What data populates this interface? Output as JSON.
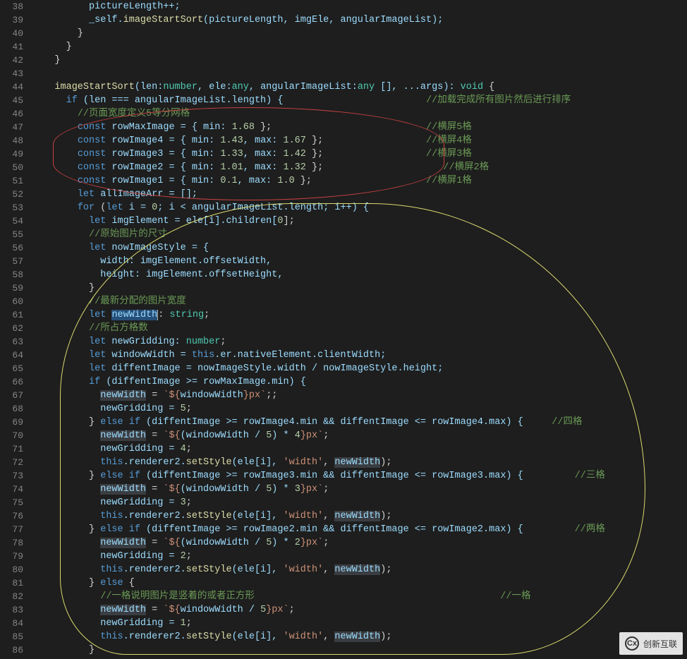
{
  "lines": {
    "start": 38,
    "end": 86
  },
  "code": {
    "l38": "          pictureLength++;",
    "l39_a": "          _self.",
    "l39_fn": "imageStartSort",
    "l39_b": "(pictureLength, imgEle, angularImageList);",
    "l40": "        }",
    "l41": "      }",
    "l42": "    }",
    "l43": "",
    "l44_a": "    ",
    "l44_fn": "imageStartSort",
    "l44_b": "(len:",
    "l44_t1": "number",
    "l44_c": ", ele:",
    "l44_t2": "any",
    "l44_d": ", angularImageList:",
    "l44_t3": "any",
    "l44_e": " [], ...args): ",
    "l44_t4": "void",
    "l44_f": " {",
    "l45_a": "      ",
    "l45_if": "if",
    "l45_b": " (len === angularImageList.length) {",
    "l45_c": "                         ",
    "l45_cmt": "//加载完成所有图片然后进行排序",
    "l46_a": "        ",
    "l46_cmt": "//页面宽度定义5等分网格",
    "l47_a": "        ",
    "l47_kw": "const",
    "l47_b": " rowMaxImage = { min: ",
    "l47_n": "1.68",
    "l47_c": " };",
    "l47_sp": "                           ",
    "l47_cmt": "//横屏5格",
    "l48_a": "        ",
    "l48_kw": "const",
    "l48_b": " rowImage4 = { min: ",
    "l48_n1": "1.43",
    "l48_c": ", max: ",
    "l48_n2": "1.67",
    "l48_d": " };",
    "l48_sp": "                  ",
    "l48_cmt": "//横屏4格",
    "l49_a": "        ",
    "l49_kw": "const",
    "l49_b": " rowImage3 = { min: ",
    "l49_n1": "1.33",
    "l49_c": ", max: ",
    "l49_n2": "1.42",
    "l49_d": " };",
    "l49_sp": "                  ",
    "l49_cmt": "//横屏3格",
    "l50_a": "        ",
    "l50_kw": "const",
    "l50_b": " rowImage2 = { min: ",
    "l50_n1": "1.01",
    "l50_c": ", max: ",
    "l50_n2": "1.32",
    "l50_d": " };",
    "l50_sp": "                     ",
    "l50_cmt": "//横屏2格",
    "l51_a": "        ",
    "l51_kw": "const",
    "l51_b": " rowImage1 = { min: ",
    "l51_n1": "0.1",
    "l51_c": ", max: ",
    "l51_n2": "1.0",
    "l51_d": " };",
    "l51_sp": "                    ",
    "l51_cmt": "//横屏1格",
    "l52_a": "        ",
    "l52_kw": "let",
    "l52_b": " allImageArr = [];",
    "l53_a": "        ",
    "l53_for": "for",
    "l53_b": " (",
    "l53_let": "let",
    "l53_c": " i = ",
    "l53_n0": "0",
    "l53_d": "; i < angularImageList.length; i++) {",
    "l54_a": "          ",
    "l54_kw": "let",
    "l54_b": " imgElement = ele[i].children[",
    "l54_n": "0",
    "l54_c": "];",
    "l55_a": "          ",
    "l55_cmt": "//原始图片的尺寸",
    "l56_a": "          ",
    "l56_kw": "let",
    "l56_b": " nowImageStyle = {",
    "l57": "            width: imgElement.offsetWidth,",
    "l58": "            height: imgElement.offsetHeight,",
    "l59": "          }",
    "l60_a": "          ",
    "l60_cmt": "//最新分配的图片宽度",
    "l61_a": "          ",
    "l61_kw": "let",
    "l61_sp": " ",
    "l61_hl": "newWidth",
    "l61_b": ": ",
    "l61_t": "string",
    "l61_c": ";",
    "l62_a": "          ",
    "l62_cmt": "//所占方格数",
    "l63_a": "          ",
    "l63_kw": "let",
    "l63_b": " newGridding: ",
    "l63_t": "number",
    "l63_c": ";",
    "l64_a": "          ",
    "l64_kw": "let",
    "l64_b": " windowWidth = ",
    "l64_this": "this",
    "l64_c": ".er.nativeElement.clientWidth;",
    "l65_a": "          ",
    "l65_kw": "let",
    "l65_b": " diffentImage = nowImageStyle.width / nowImageStyle.height;",
    "l66_a": "          ",
    "l66_if": "if",
    "l66_b": " (diffentImage >= rowMaxImage.min) {",
    "l67_a": "            ",
    "l67_hl": "newWidth",
    "l67_b": " = ",
    "l67_s1": "`${",
    "l67_v": "windowWidth",
    "l67_s2": "}px`",
    "l67_c": ";;",
    "l68_a": "            newGridding = ",
    "l68_n": "5",
    "l68_b": ";",
    "l69_a": "          } ",
    "l69_e": "else if",
    "l69_b": " (diffentImage >= rowImage4.min && diffentImage <= rowImage4.max) {",
    "l69_sp": "     ",
    "l69_cmt": "//四格",
    "l70_a": "            ",
    "l70_hl": "newWidth",
    "l70_b": " = ",
    "l70_s1": "`${",
    "l70_v": "(windowWidth / ",
    "l70_n5": "5",
    "l70_v2": ") * ",
    "l70_n4": "4",
    "l70_s2": "}px`",
    "l70_c": ";",
    "l71_a": "            newGridding = ",
    "l71_n": "4",
    "l71_b": ";",
    "l72_a": "            ",
    "l72_this": "this",
    "l72_b": ".renderer2.",
    "l72_fn": "setStyle",
    "l72_c": "(ele[i], ",
    "l72_s": "'width'",
    "l72_d": ", ",
    "l72_hl": "newWidth",
    "l72_e": ");",
    "l73_a": "          } ",
    "l73_e": "else if",
    "l73_b": " (diffentImage >= rowImage3.min && diffentImage <= rowImage3.max) {",
    "l73_sp": "         ",
    "l73_cmt": "//三格",
    "l74_a": "            ",
    "l74_hl": "newWidth",
    "l74_b": " = ",
    "l74_s1": "`${",
    "l74_v": "(windowWidth / ",
    "l74_n5": "5",
    "l74_v2": ") * ",
    "l74_n3": "3",
    "l74_s2": "}px`",
    "l74_c": ";",
    "l75_a": "            newGridding = ",
    "l75_n": "3",
    "l75_b": ";",
    "l76_a": "            ",
    "l76_this": "this",
    "l76_b": ".renderer2.",
    "l76_fn": "setStyle",
    "l76_c": "(ele[i], ",
    "l76_s": "'width'",
    "l76_d": ", ",
    "l76_hl": "newWidth",
    "l76_e": ");",
    "l77_a": "          } ",
    "l77_e": "else if",
    "l77_b": " (diffentImage >= rowImage2.min && diffentImage <= rowImage2.max) {",
    "l77_sp": "         ",
    "l77_cmt": "//两格",
    "l78_a": "            ",
    "l78_hl": "newWidth",
    "l78_b": " = ",
    "l78_s1": "`${",
    "l78_v": "(windowWidth / ",
    "l78_n5": "5",
    "l78_v2": ") * ",
    "l78_n2": "2",
    "l78_s2": "}px`",
    "l78_c": ";",
    "l79_a": "            newGridding = ",
    "l79_n": "2",
    "l79_b": ";",
    "l80_a": "            ",
    "l80_this": "this",
    "l80_b": ".renderer2.",
    "l80_fn": "setStyle",
    "l80_c": "(ele[i], ",
    "l80_s": "'width'",
    "l80_d": ", ",
    "l80_hl": "newWidth",
    "l80_e": ");",
    "l81_a": "          } ",
    "l81_e": "else",
    "l81_b": " {",
    "l82_a": "            ",
    "l82_cmt": "//一格说明图片是竖着的或者正方形",
    "l82_sp": "                                           ",
    "l82_cmt2": "//一格",
    "l83_a": "            ",
    "l83_hl": "newWidth",
    "l83_b": " = ",
    "l83_s1": "`${",
    "l83_v": "windowWidth / ",
    "l83_n5": "5",
    "l83_s2": "}px`",
    "l83_c": ";",
    "l84_a": "            newGridding = ",
    "l84_n": "1",
    "l84_b": ";",
    "l85_a": "            ",
    "l85_this": "this",
    "l85_b": ".renderer2.",
    "l85_fn": "setStyle",
    "l85_c": "(ele[i], ",
    "l85_s": "'width'",
    "l85_d": ", ",
    "l85_hl": "newWidth",
    "l85_e": ");",
    "l86": "          }"
  },
  "watermark": {
    "text": "创新互联",
    "logo": "Cx"
  }
}
